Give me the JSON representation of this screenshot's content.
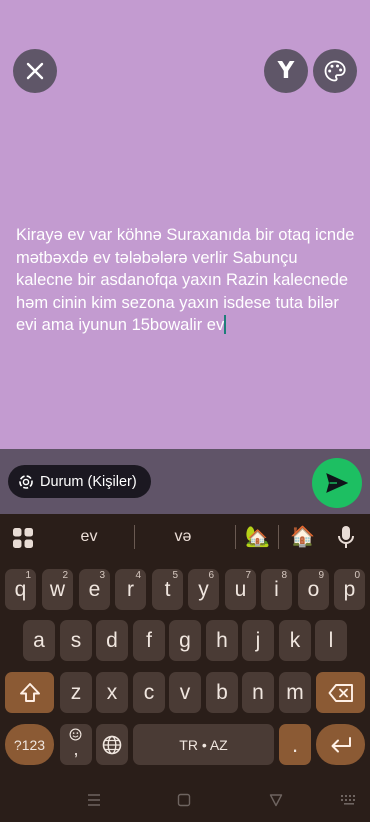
{
  "header": {
    "close_icon": "close-icon",
    "font_button_label": "Y",
    "palette_icon": "palette-icon"
  },
  "status": {
    "text": "Kirayə ev var köhnə Suraxanıda bir otaq icnde mətbəxdə ev tələbələrə verlir  Sabunçu kalecne bir asdanofqa yaxın Razin kalecnede həm cinin kim sezona yaxın isdese  tuta bilər evi ama iyunun 15bowalir ev",
    "background_color": "#c39bd0"
  },
  "audience": {
    "label": "Durum (Kişiler)",
    "icon": "status-ring-icon"
  },
  "send": {
    "icon": "send-icon",
    "color": "#1dbf62"
  },
  "keyboard": {
    "suggestions": [
      "ev",
      "və"
    ],
    "emoji_suggestions": [
      "🏡",
      "🏠"
    ],
    "row1": [
      {
        "k": "q",
        "h": "1"
      },
      {
        "k": "w",
        "h": "2"
      },
      {
        "k": "e",
        "h": "3"
      },
      {
        "k": "r",
        "h": "4"
      },
      {
        "k": "t",
        "h": "5"
      },
      {
        "k": "y",
        "h": "6"
      },
      {
        "k": "u",
        "h": "7"
      },
      {
        "k": "i",
        "h": "8"
      },
      {
        "k": "o",
        "h": "9"
      },
      {
        "k": "p",
        "h": "0"
      }
    ],
    "row2": [
      "a",
      "s",
      "d",
      "f",
      "g",
      "h",
      "j",
      "k",
      "l"
    ],
    "row3": [
      "z",
      "x",
      "c",
      "v",
      "b",
      "n",
      "m"
    ],
    "symbols_label": "?123",
    "comma_label": ",",
    "space_label": "TR • AZ",
    "period_label": ".",
    "fn_color": "#8b5a34"
  }
}
